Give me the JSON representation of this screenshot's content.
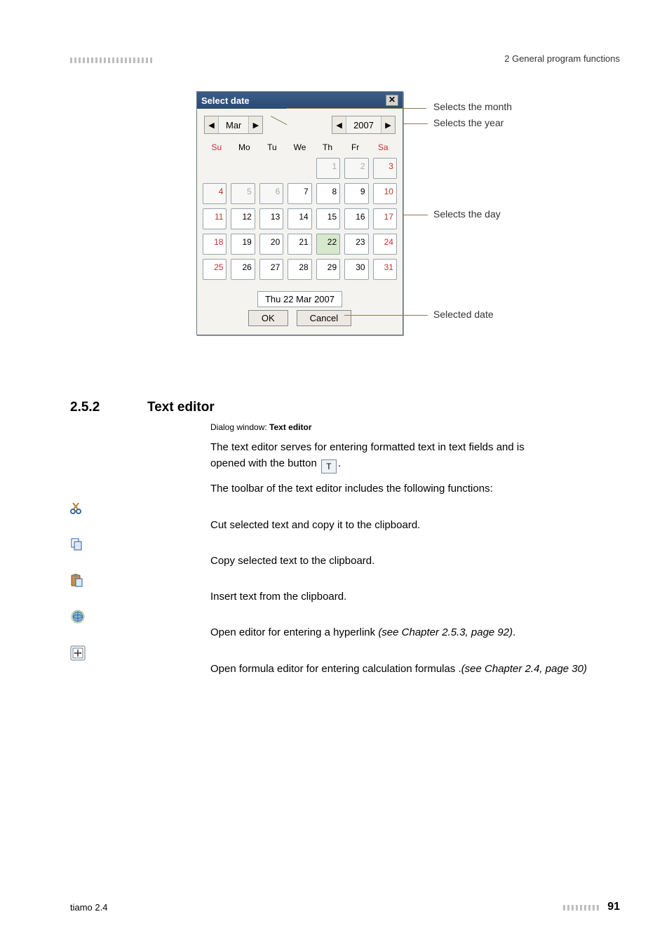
{
  "header": {
    "breadcrumb": "2 General program functions"
  },
  "dialog": {
    "title": "Select date",
    "month": "Mar",
    "year": "2007",
    "days": [
      "Su",
      "Mo",
      "Tu",
      "We",
      "Th",
      "Fr",
      "Sa"
    ],
    "grid": [
      [
        null,
        null,
        null,
        null,
        {
          "n": 1,
          "dim": true
        },
        {
          "n": 2,
          "dim": true
        },
        {
          "n": 3,
          "dim": true,
          "weekend": true
        }
      ],
      [
        {
          "n": 4,
          "dim": true,
          "weekend": true
        },
        {
          "n": 5,
          "dim": true
        },
        {
          "n": 6,
          "dim": true
        },
        {
          "n": 7
        },
        {
          "n": 8
        },
        {
          "n": 9
        },
        {
          "n": 10,
          "weekend": true
        }
      ],
      [
        {
          "n": 11,
          "weekend": true
        },
        {
          "n": 12
        },
        {
          "n": 13
        },
        {
          "n": 14
        },
        {
          "n": 15
        },
        {
          "n": 16
        },
        {
          "n": 17,
          "weekend": true
        }
      ],
      [
        {
          "n": 18,
          "weekend": true
        },
        {
          "n": 19
        },
        {
          "n": 20
        },
        {
          "n": 21
        },
        {
          "n": 22,
          "today": true
        },
        {
          "n": 23
        },
        {
          "n": 24,
          "weekend": true
        }
      ],
      [
        {
          "n": 25,
          "weekend": true
        },
        {
          "n": 26
        },
        {
          "n": 27
        },
        {
          "n": 28
        },
        {
          "n": 29
        },
        {
          "n": 30
        },
        {
          "n": 31,
          "weekend": true
        }
      ]
    ],
    "selected": "Thu  22 Mar 2007",
    "ok": "OK",
    "cancel": "Cancel"
  },
  "callouts": {
    "month": "Selects the month",
    "year": "Selects the year",
    "day": "Selects the day",
    "selected": "Selected date"
  },
  "section": {
    "number": "2.5.2",
    "title": "Text editor",
    "subhead_prefix": "Dialog window: ",
    "subhead_bold": "Text editor",
    "p1a": "The text editor serves for entering formatted text in text fields and is",
    "p1b_pre": "opened with the button ",
    "p1b_post": ".",
    "t_button": "T",
    "p2": "The toolbar of the text editor includes the following functions:",
    "funcs": [
      "Cut selected text and copy it to the clipboard.",
      "Copy selected text to the clipboard.",
      "Insert text from the clipboard.",
      "Open editor for entering a hyperlink (see Chapter 2.5.3, page 92).",
      "Open formula editor for entering calculation formulas .(see Chapter 2.4, page 30)"
    ],
    "func4_plain": "Open editor for entering a hyperlink ",
    "func4_italic": "(see Chapter 2.5.3, page 92)",
    "func4_end": ".",
    "func5_plain": "Open formula editor for entering calculation formulas .",
    "func5_italic": "(see Chapter 2.4, page 30)"
  },
  "footer": {
    "left": "tiamo 2.4",
    "page": "91"
  }
}
